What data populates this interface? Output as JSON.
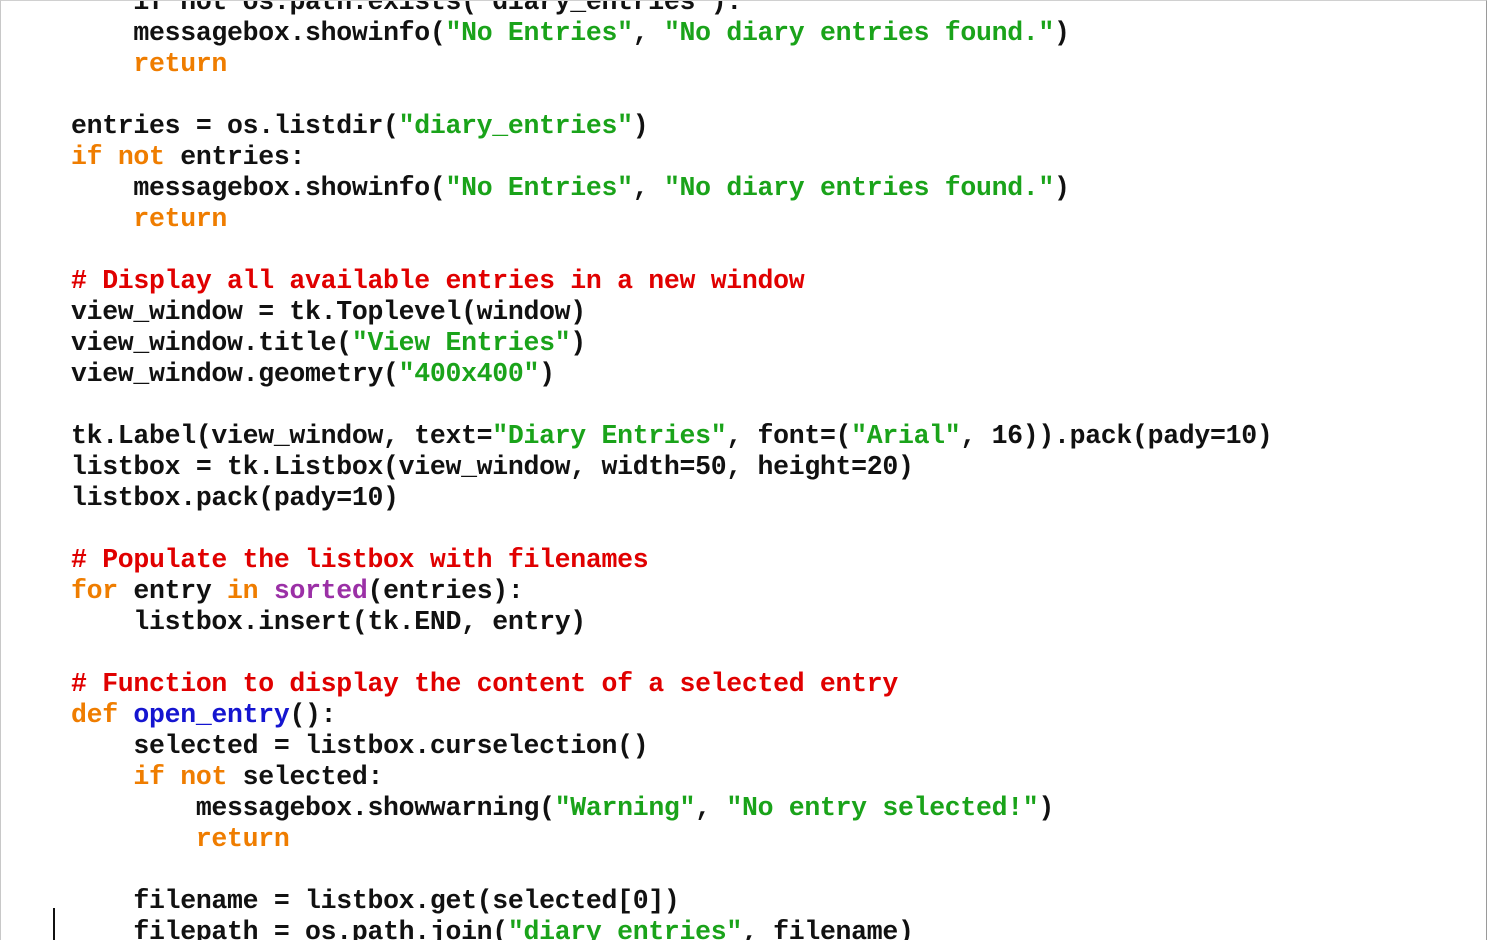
{
  "editor": {
    "colors": {
      "keyword": "#ef7d00",
      "string": "#1aa31a",
      "comment": "#e00000",
      "function_name": "#1515d0",
      "builtin": "#9b30a6",
      "identifier": "#111111",
      "background": "#ffffff"
    },
    "lines": [
      {
        "indent": 4,
        "tokens": [
          {
            "k": "id",
            "t": "if not os.path.exists(\"diary_entries\"):"
          }
        ]
      },
      {
        "indent": 4,
        "tokens": [
          {
            "k": "id",
            "t": "messagebox.showinfo("
          },
          {
            "k": "str",
            "t": "\"No Entries\""
          },
          {
            "k": "id",
            "t": ", "
          },
          {
            "k": "str",
            "t": "\"No diary entries found.\""
          },
          {
            "k": "id",
            "t": ")"
          }
        ]
      },
      {
        "indent": 4,
        "tokens": [
          {
            "k": "kw",
            "t": "return"
          }
        ]
      },
      {
        "indent": 0,
        "tokens": []
      },
      {
        "indent": 0,
        "tokens": [
          {
            "k": "id",
            "t": "entries = os.listdir("
          },
          {
            "k": "str",
            "t": "\"diary_entries\""
          },
          {
            "k": "id",
            "t": ")"
          }
        ]
      },
      {
        "indent": 0,
        "tokens": [
          {
            "k": "kw",
            "t": "if"
          },
          {
            "k": "id",
            "t": " "
          },
          {
            "k": "kw",
            "t": "not"
          },
          {
            "k": "id",
            "t": " entries:"
          }
        ]
      },
      {
        "indent": 4,
        "tokens": [
          {
            "k": "id",
            "t": "messagebox.showinfo("
          },
          {
            "k": "str",
            "t": "\"No Entries\""
          },
          {
            "k": "id",
            "t": ", "
          },
          {
            "k": "str",
            "t": "\"No diary entries found.\""
          },
          {
            "k": "id",
            "t": ")"
          }
        ]
      },
      {
        "indent": 4,
        "tokens": [
          {
            "k": "kw",
            "t": "return"
          }
        ]
      },
      {
        "indent": 0,
        "tokens": []
      },
      {
        "indent": 0,
        "tokens": [
          {
            "k": "com",
            "t": "# Display all available entries in a new window"
          }
        ]
      },
      {
        "indent": 0,
        "tokens": [
          {
            "k": "id",
            "t": "view_window = tk.Toplevel(window)"
          }
        ]
      },
      {
        "indent": 0,
        "tokens": [
          {
            "k": "id",
            "t": "view_window.title("
          },
          {
            "k": "str",
            "t": "\"View Entries\""
          },
          {
            "k": "id",
            "t": ")"
          }
        ]
      },
      {
        "indent": 0,
        "tokens": [
          {
            "k": "id",
            "t": "view_window.geometry("
          },
          {
            "k": "str",
            "t": "\"400x400\""
          },
          {
            "k": "id",
            "t": ")"
          }
        ]
      },
      {
        "indent": 0,
        "tokens": []
      },
      {
        "indent": 0,
        "tokens": [
          {
            "k": "id",
            "t": "tk.Label(view_window, text="
          },
          {
            "k": "str",
            "t": "\"Diary Entries\""
          },
          {
            "k": "id",
            "t": ", font=("
          },
          {
            "k": "str",
            "t": "\"Arial\""
          },
          {
            "k": "id",
            "t": ", 16)).pack(pady=10)"
          }
        ]
      },
      {
        "indent": 0,
        "tokens": [
          {
            "k": "id",
            "t": "listbox = tk.Listbox(view_window, width=50, height=20)"
          }
        ]
      },
      {
        "indent": 0,
        "tokens": [
          {
            "k": "id",
            "t": "listbox.pack(pady=10)"
          }
        ]
      },
      {
        "indent": 0,
        "tokens": []
      },
      {
        "indent": 0,
        "tokens": [
          {
            "k": "com",
            "t": "# Populate the listbox with filenames"
          }
        ]
      },
      {
        "indent": 0,
        "tokens": [
          {
            "k": "kw",
            "t": "for"
          },
          {
            "k": "id",
            "t": " entry "
          },
          {
            "k": "kw",
            "t": "in"
          },
          {
            "k": "id",
            "t": " "
          },
          {
            "k": "bi",
            "t": "sorted"
          },
          {
            "k": "id",
            "t": "(entries):"
          }
        ]
      },
      {
        "indent": 4,
        "tokens": [
          {
            "k": "id",
            "t": "listbox.insert(tk.END, entry)"
          }
        ]
      },
      {
        "indent": 0,
        "tokens": []
      },
      {
        "indent": 0,
        "tokens": [
          {
            "k": "com",
            "t": "# Function to display the content of a selected entry"
          }
        ]
      },
      {
        "indent": 0,
        "tokens": [
          {
            "k": "kw",
            "t": "def"
          },
          {
            "k": "id",
            "t": " "
          },
          {
            "k": "fn",
            "t": "open_entry"
          },
          {
            "k": "id",
            "t": "():"
          }
        ]
      },
      {
        "indent": 4,
        "tokens": [
          {
            "k": "id",
            "t": "selected = listbox.curselection()"
          }
        ]
      },
      {
        "indent": 4,
        "tokens": [
          {
            "k": "kw",
            "t": "if"
          },
          {
            "k": "id",
            "t": " "
          },
          {
            "k": "kw",
            "t": "not"
          },
          {
            "k": "id",
            "t": " selected:"
          }
        ]
      },
      {
        "indent": 8,
        "tokens": [
          {
            "k": "id",
            "t": "messagebox.showwarning("
          },
          {
            "k": "str",
            "t": "\"Warning\""
          },
          {
            "k": "id",
            "t": ", "
          },
          {
            "k": "str",
            "t": "\"No entry selected!\""
          },
          {
            "k": "id",
            "t": ")"
          }
        ]
      },
      {
        "indent": 8,
        "tokens": [
          {
            "k": "kw",
            "t": "return"
          }
        ]
      },
      {
        "indent": 0,
        "tokens": []
      },
      {
        "indent": 4,
        "tokens": [
          {
            "k": "id",
            "t": "filename = listbox.get(selected[0])"
          }
        ]
      },
      {
        "indent": 4,
        "tokens": [
          {
            "k": "id",
            "t": "filepath = os.path.join("
          },
          {
            "k": "str",
            "t": "\"diary_entries\""
          },
          {
            "k": "id",
            "t": ", filename)"
          }
        ]
      }
    ]
  }
}
